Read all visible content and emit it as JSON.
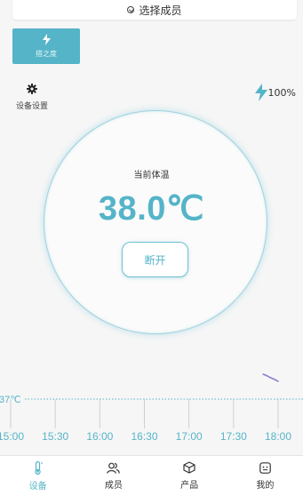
{
  "member_bar": {
    "label": "选择成员",
    "icon": "chevron-down-circle-icon"
  },
  "brand_button": {
    "label": "搭之度",
    "icon": "lightning-icon"
  },
  "settings": {
    "label": "设备设置",
    "icon": "gear-icon"
  },
  "battery": {
    "label": "100%",
    "icon": "lightning-icon",
    "level": 1.0
  },
  "temperature": {
    "caption": "当前体温",
    "value": "38.0℃"
  },
  "disconnect_button": {
    "label": "断开"
  },
  "colors": {
    "accent": "#55b4c8",
    "ring": "#9fd3df",
    "trend_line": "#8a7ad0"
  },
  "chart_data": {
    "type": "line",
    "reference_line": {
      "value": 37,
      "label": "37℃"
    },
    "x_tick_labels": [
      "15:00",
      "15:30",
      "16:00",
      "16:30",
      "17:00",
      "17:30",
      "18:00"
    ],
    "series": [
      {
        "x": [
          "17:50",
          "17:55",
          "18:00"
        ],
        "y": [
          38.4,
          38.2,
          38.0
        ]
      }
    ]
  },
  "nav": {
    "items": [
      {
        "label": "设备",
        "icon": "thermometer-icon",
        "active": true
      },
      {
        "label": "成员",
        "icon": "users-icon",
        "active": false
      },
      {
        "label": "产品",
        "icon": "box-icon",
        "active": false
      },
      {
        "label": "我的",
        "icon": "profile-icon",
        "active": false
      }
    ]
  }
}
